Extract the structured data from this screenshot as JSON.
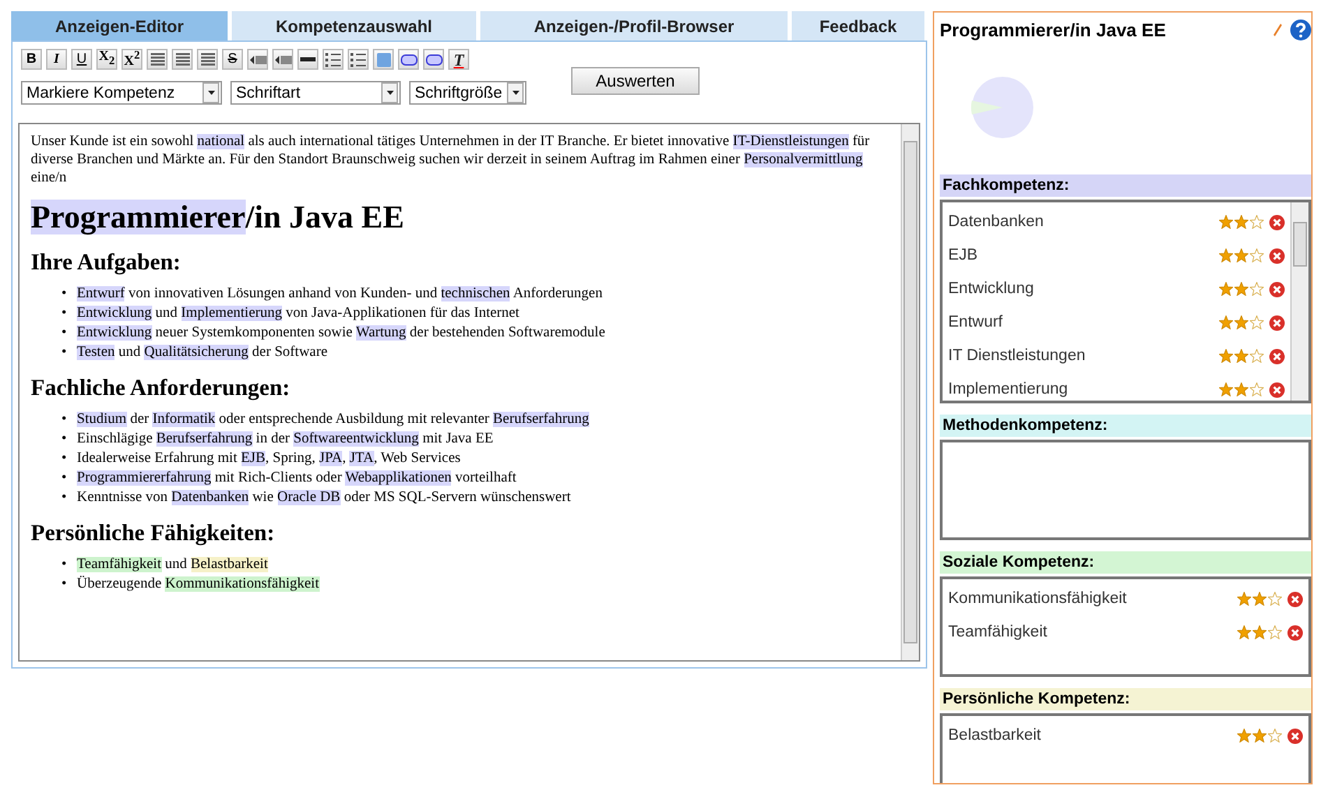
{
  "tabs": [
    {
      "label": "Anzeigen-Editor",
      "selected": true
    },
    {
      "label": "Kompetenzauswahl",
      "selected": false
    },
    {
      "label": "Anzeigen-/Profil-Browser",
      "selected": false
    },
    {
      "label": "Feedback",
      "selected": false
    }
  ],
  "toolbar": [
    {
      "kind": "bold",
      "label": "B"
    },
    {
      "kind": "italic",
      "label": "I"
    },
    {
      "kind": "underline",
      "label": "U"
    },
    {
      "kind": "sub",
      "label": "X$_{2}$"
    },
    {
      "kind": "sup",
      "label": "X$^{2}$"
    },
    {
      "kind": "align-left"
    },
    {
      "kind": "align-center"
    },
    {
      "kind": "align-right"
    },
    {
      "kind": "strike",
      "label": "S"
    },
    {
      "kind": "indent"
    },
    {
      "kind": "outdent"
    },
    {
      "kind": "rule"
    },
    {
      "kind": "ordered-list"
    },
    {
      "kind": "bullet-list"
    },
    {
      "kind": "image"
    },
    {
      "kind": "link"
    },
    {
      "kind": "unlink"
    },
    {
      "kind": "clear",
      "label": "T"
    }
  ],
  "selects": [
    {
      "value": "Markiere Kompetenz"
    },
    {
      "value": "Schriftart"
    },
    {
      "value": "Schriftgröße"
    }
  ],
  "evaluate_button": "Auswerten",
  "document": [
    {
      "kind": "paragraph",
      "segments": [
        {
          "text": "Unser Kunde ist ein sowohl "
        },
        {
          "text": "national",
          "color": "#d6d6fb"
        },
        {
          "text": " als auch international tätiges Unternehmen in der IT Branche. Er bietet innovative "
        },
        {
          "text": "IT-Dienstleistungen",
          "color": "#d6d6fb"
        },
        {
          "text": " für diverse Branchen und Märkte an. Für den Standort Braunschweig suchen wir derzeit in seinem Auftrag im Rahmen einer "
        },
        {
          "text": "Personalvermittlung",
          "color": "#d6d6fb"
        },
        {
          "text": " eine/n"
        }
      ]
    },
    {
      "kind": "title",
      "segments": [
        {
          "text": "Programmierer",
          "color": "#d6d6fb"
        },
        {
          "text": "/in Java EE"
        }
      ]
    },
    {
      "kind": "heading",
      "segments": [
        {
          "text": "Ihre Aufgaben:"
        }
      ]
    },
    {
      "kind": "list",
      "items": [
        {
          "bullet": "•",
          "segments": [
            {
              "text": "Entwurf",
              "color": "#d6d6fb"
            },
            {
              "text": " von innovativen Lösungen anhand von Kunden- und "
            },
            {
              "text": "technischen",
              "color": "#d6d6fb"
            },
            {
              "text": " Anforderungen"
            }
          ]
        },
        {
          "bullet": "•",
          "segments": [
            {
              "text": "Entwicklung",
              "color": "#d6d6fb"
            },
            {
              "text": " und "
            },
            {
              "text": "Implementierung",
              "color": "#d6d6fb"
            },
            {
              "text": " von Java-Applikationen für das Internet"
            }
          ]
        },
        {
          "bullet": "•",
          "segments": [
            {
              "text": "Entwicklung",
              "color": "#d6d6fb"
            },
            {
              "text": " neuer Systemkomponenten sowie "
            },
            {
              "text": "Wartung",
              "color": "#d6d6fb"
            },
            {
              "text": " der bestehenden Softwaremodule"
            }
          ]
        },
        {
          "bullet": "•",
          "segments": [
            {
              "text": "Testen",
              "color": "#d6d6fb"
            },
            {
              "text": " und "
            },
            {
              "text": "Qualitätsicherung",
              "color": "#d6d6fb"
            },
            {
              "text": " der Software"
            }
          ]
        }
      ]
    },
    {
      "kind": "heading",
      "segments": [
        {
          "text": "Fachliche Anforderungen:"
        }
      ]
    },
    {
      "kind": "list",
      "items": [
        {
          "bullet": "•",
          "segments": [
            {
              "text": "Studium",
              "color": "#d6d6fb"
            },
            {
              "text": " der "
            },
            {
              "text": "Informatik",
              "color": "#d6d6fb"
            },
            {
              "text": " oder entsprechende Ausbildung mit relevanter "
            },
            {
              "text": "Berufserfahrung",
              "color": "#d6d6fb"
            }
          ]
        },
        {
          "bullet": "•",
          "segments": [
            {
              "text": "Einschlägige "
            },
            {
              "text": "Berufserfahrung",
              "color": "#d6d6fb"
            },
            {
              "text": " in der "
            },
            {
              "text": "Softwareentwicklung",
              "color": "#d6d6fb"
            },
            {
              "text": " mit Java EE"
            }
          ]
        },
        {
          "bullet": "•",
          "segments": [
            {
              "text": "Idealerweise Erfahrung mit "
            },
            {
              "text": "EJB",
              "color": "#d6d6fb"
            },
            {
              "text": ", Spring, "
            },
            {
              "text": "JPA",
              "color": "#d6d6fb"
            },
            {
              "text": ", "
            },
            {
              "text": "JTA",
              "color": "#d6d6fb"
            },
            {
              "text": ", Web Services"
            }
          ]
        },
        {
          "bullet": "•",
          "segments": [
            {
              "text": "Programmiererfahrung",
              "color": "#d6d6fb"
            },
            {
              "text": " mit Rich-Clients oder "
            },
            {
              "text": "Webapplikationen",
              "color": "#d6d6fb"
            },
            {
              "text": " vorteilhaft"
            }
          ]
        },
        {
          "bullet": "•",
          "segments": [
            {
              "text": "Kenntnisse von "
            },
            {
              "text": "Datenbanken",
              "color": "#d6d6fb"
            },
            {
              "text": " wie "
            },
            {
              "text": "Oracle DB",
              "color": "#d6d6fb"
            },
            {
              "text": " oder MS SQL-Servern wünschenswert"
            }
          ]
        }
      ]
    },
    {
      "kind": "heading",
      "segments": [
        {
          "text": "Persönliche Fähigkeiten:"
        }
      ]
    },
    {
      "kind": "list",
      "items": [
        {
          "bullet": "•",
          "segments": [
            {
              "text": "Teamfähigkeit",
              "color": "#cdf3cd"
            },
            {
              "text": " und "
            },
            {
              "text": "Belastbarkeit",
              "color": "#f6f1c8"
            }
          ]
        },
        {
          "bullet": "•",
          "segments": [
            {
              "text": "Überzeugende "
            },
            {
              "text": "Kommunikationsfähigkeit",
              "color": "#cdf3cd"
            }
          ]
        }
      ]
    }
  ],
  "profile": {
    "title": "Programmierer/in Java EE",
    "sections": [
      {
        "title": "Fachkompetenz:",
        "color": "#d5d5f7",
        "items": [
          {
            "name": "Datenbanken",
            "stars": 2
          },
          {
            "name": "EJB",
            "stars": 2
          },
          {
            "name": "Entwicklung",
            "stars": 2
          },
          {
            "name": "Entwurf",
            "stars": 2
          },
          {
            "name": "IT Dienstleistungen",
            "stars": 2
          },
          {
            "name": "Implementierung",
            "stars": 2
          }
        ]
      },
      {
        "title": "Methodenkompetenz:",
        "color": "#d3f4f4"
      },
      {
        "title": "Soziale Kompetenz:",
        "color": "#d3f5d3",
        "items": [
          {
            "name": "Kommunikationsfähigkeit",
            "stars": 2
          },
          {
            "name": "Teamfähigkeit",
            "stars": 2
          }
        ]
      },
      {
        "title": "Persönliche Kompetenz:",
        "color": "#f5f3d3",
        "items": [
          {
            "name": "Belastbarkeit",
            "stars": 2
          }
        ]
      }
    ]
  }
}
